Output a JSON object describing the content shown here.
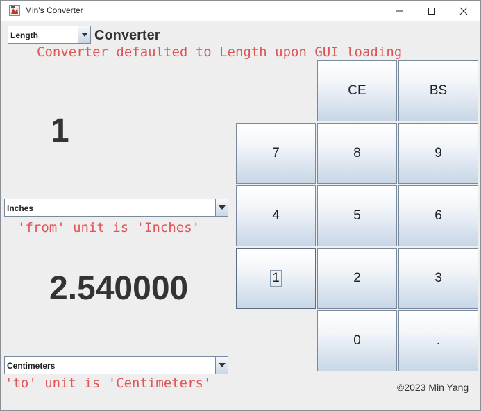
{
  "window": {
    "title": "Min's Converter",
    "controls": {
      "minimize": "─",
      "maximize": "☐",
      "close": "✕"
    }
  },
  "converter_type": {
    "selected": "Length",
    "label": "Converter"
  },
  "annotations": {
    "defaulted": "Converter defaulted to Length upon GUI loading",
    "from": "'from' unit is 'Inches'",
    "to": "'to' unit is 'Centimeters'"
  },
  "input_value": "1",
  "from_unit": {
    "selected": "Inches"
  },
  "output_value": "2.540000",
  "to_unit": {
    "selected": "Centimeters"
  },
  "keypad": {
    "ce": "CE",
    "bs": "BS",
    "k7": "7",
    "k8": "8",
    "k9": "9",
    "k4": "4",
    "k5": "5",
    "k6": "6",
    "k1": "1",
    "k2": "2",
    "k3": "3",
    "k0": "0",
    "dot": "."
  },
  "footer": {
    "copyright": "©2023 Min Yang"
  }
}
